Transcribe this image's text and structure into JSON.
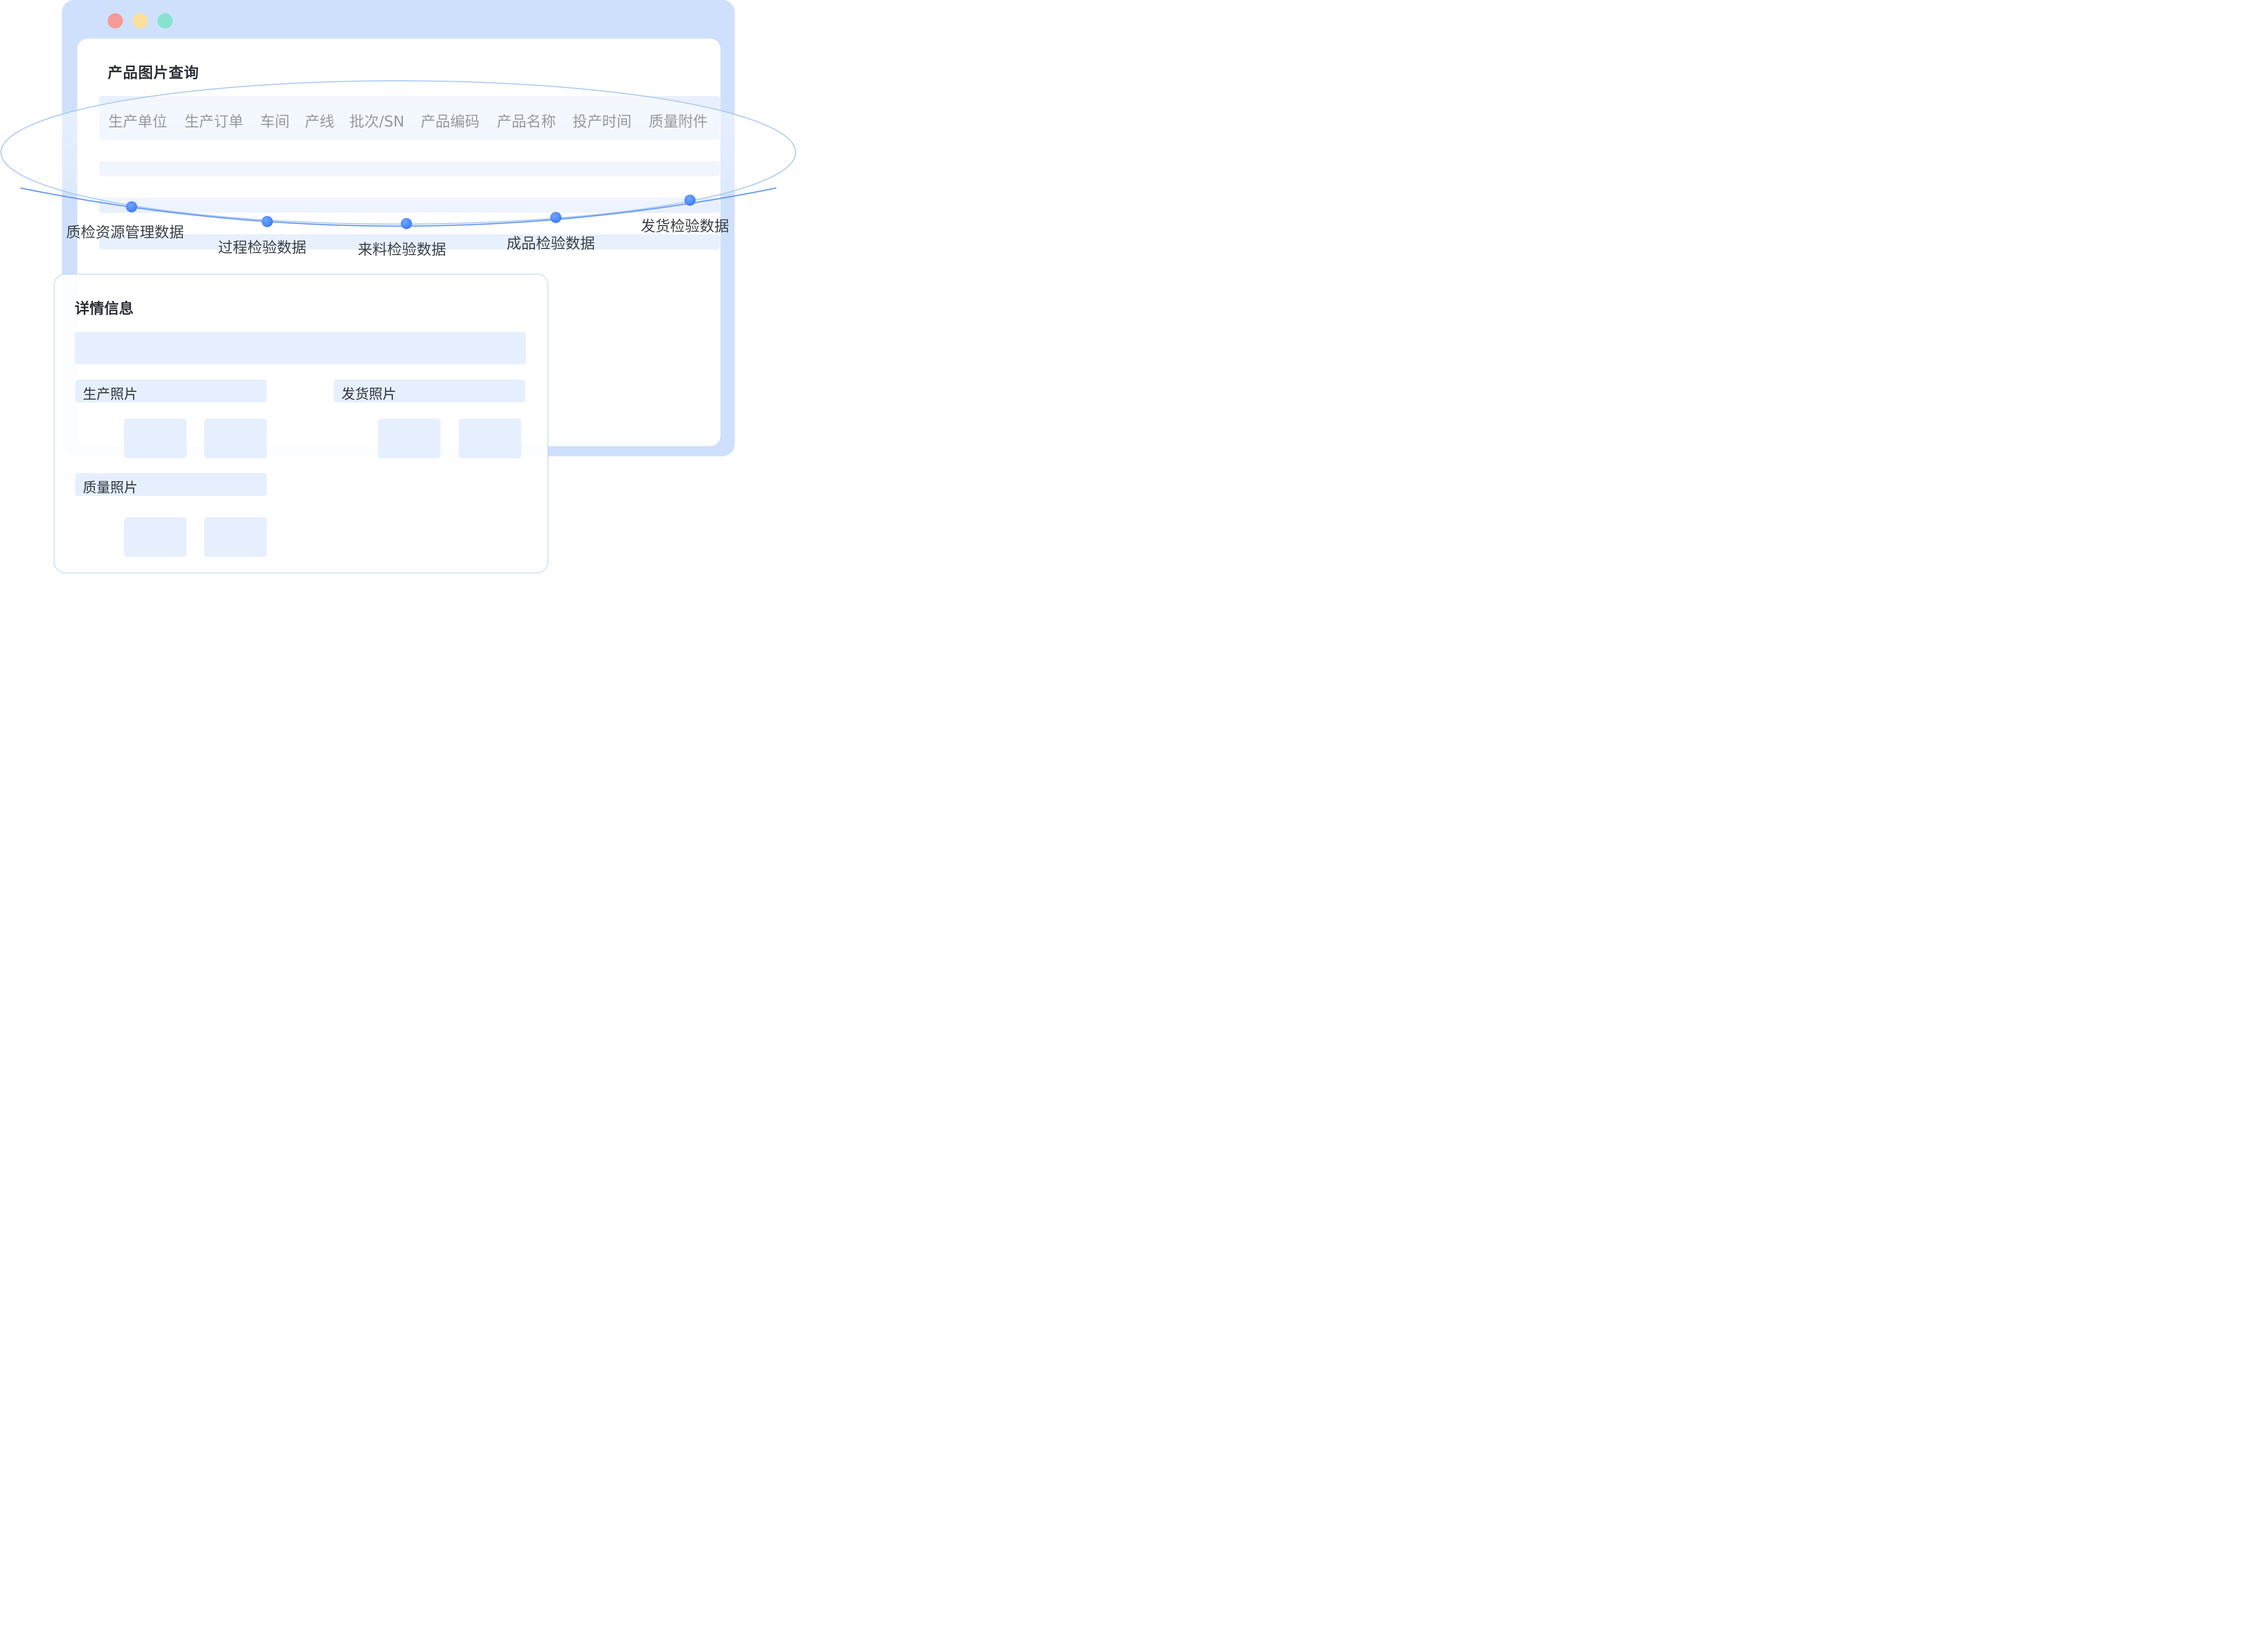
{
  "window": {
    "title": "产品图片查询",
    "filters": [
      "生产单位",
      "生产订单",
      "车间",
      "产线",
      "批次/SN",
      "产品编码",
      "产品名称",
      "投产时间",
      "质量附件"
    ]
  },
  "stages": [
    "质检资源管理数据",
    "过程检验数据",
    "来料检验数据",
    "成品检验数据",
    "发货检验数据"
  ],
  "detail": {
    "title": "详情信息",
    "sections": {
      "production_photos": "生产照片",
      "shipping_photos": "发货照片",
      "quality_photos": "质量照片"
    }
  },
  "colors": {
    "window_frame": "#cfe0fc",
    "accent": "#3b7cf2",
    "bar_fill": "#e8f0fd"
  }
}
